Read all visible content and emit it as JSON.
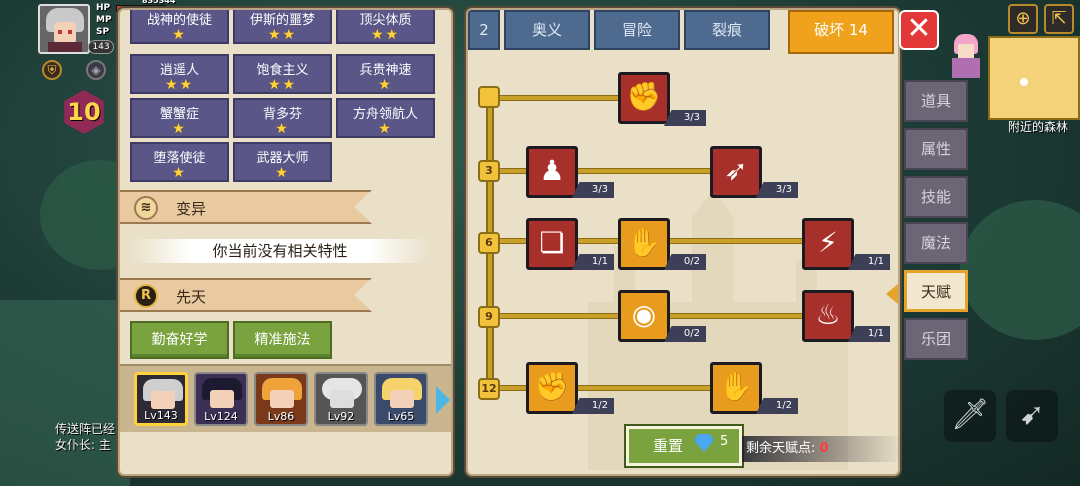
{
  "hud": {
    "level": "143",
    "hp_label": "HP",
    "mp_label": "MP",
    "sp_label": "SP",
    "hp_value": "835344",
    "hex_level": "10"
  },
  "left_panel": {
    "traits": [
      {
        "name": "战神的使徒",
        "stars": "★"
      },
      {
        "name": "伊斯的噩梦",
        "stars": "★★"
      },
      {
        "name": "顶尖体质",
        "stars": "★★"
      },
      {
        "name": "逍遥人",
        "stars": "★★"
      },
      {
        "name": "饱食主义",
        "stars": "★★"
      },
      {
        "name": "兵贵神速",
        "stars": "★"
      },
      {
        "name": "蟹蟹症",
        "stars": "★"
      },
      {
        "name": "背多芬",
        "stars": "★"
      },
      {
        "name": "方舟领航人",
        "stars": "★"
      },
      {
        "name": "堕落使徒",
        "stars": "★"
      },
      {
        "name": "武器大师",
        "stars": "★"
      }
    ],
    "mutation_title": "变异",
    "no_trait_text": "你当前没有相关特性",
    "innate_title": "先天",
    "innate_icon": "R",
    "innate_traits": [
      "勤奋好学",
      "精准施法"
    ],
    "heroes": [
      {
        "level": "Lv143"
      },
      {
        "level": "Lv124"
      },
      {
        "level": "Lv86"
      },
      {
        "level": "Lv92"
      },
      {
        "level": "Lv65"
      }
    ]
  },
  "tree_panel": {
    "tabs": [
      {
        "label": "2"
      },
      {
        "label": "奥义"
      },
      {
        "label": "冒险"
      },
      {
        "label": "裂痕"
      },
      {
        "label": "破坏 14"
      }
    ],
    "tiers": [
      "3",
      "6",
      "9",
      "12"
    ],
    "nodes": [
      {
        "icon": "✊",
        "count": "3/3"
      },
      {
        "icon": "♟",
        "count": "3/3"
      },
      {
        "icon": "➶",
        "count": "3/3"
      },
      {
        "icon": "❏",
        "count": "1/1"
      },
      {
        "icon": "✋",
        "count": "0/2"
      },
      {
        "icon": "⚡",
        "count": "1/1"
      },
      {
        "icon": "◉",
        "count": "0/2"
      },
      {
        "icon": "♨",
        "count": "1/1"
      },
      {
        "icon": "✊",
        "count": "1/2"
      },
      {
        "icon": "✋",
        "count": "1/2"
      }
    ],
    "reset_label": "重置",
    "reset_cost": "5",
    "remaining_label": "剩余天赋点:",
    "remaining_value": "0"
  },
  "side_nav": {
    "items": [
      "道具",
      "属性",
      "技能",
      "魔法",
      "天赋",
      "乐团"
    ],
    "active": "天赋"
  },
  "map": {
    "label": "附近的森林"
  },
  "chat": {
    "line1": "传送阵已经",
    "line2": "女仆长: 主"
  },
  "colors": {
    "panel": "#eadfc7",
    "tab_active": "#f0a21c",
    "tab": "#4e6a8e",
    "trait": "#5a5688",
    "green_button": "#7aa33f",
    "line_gold": "#c9a028"
  }
}
